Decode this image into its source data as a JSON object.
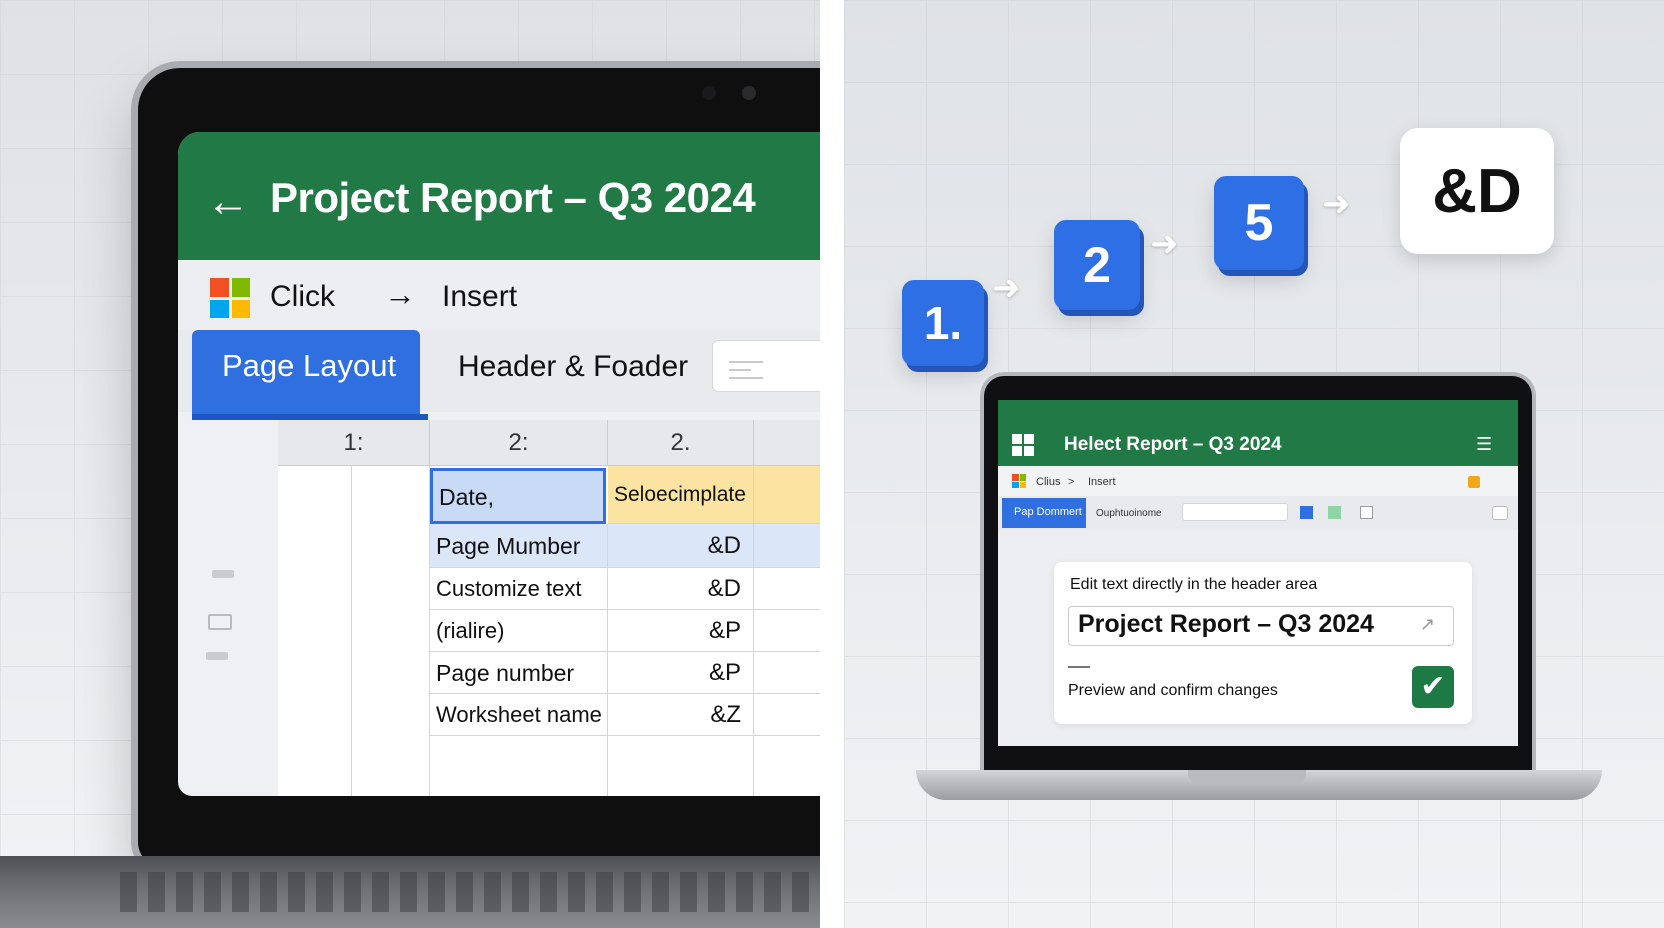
{
  "left": {
    "window_title": "Project Report – Q3 2024",
    "toolbar": {
      "click_label": "Click",
      "arrow": "→",
      "insert_label": "Insert"
    },
    "tabs": [
      {
        "label": "Page Layout",
        "active": true
      },
      {
        "label": "Header & Foader",
        "active": false
      }
    ],
    "table": {
      "columns": [
        "1:",
        "2:",
        "2."
      ],
      "rows": [
        {
          "label": "Date,",
          "value": "Seloecimplate",
          "state": "selected"
        },
        {
          "label": "Page Mumber",
          "value": "&D",
          "state": "highlight"
        },
        {
          "label": "Customize text",
          "value": "&D",
          "state": "normal"
        },
        {
          "label": "(rialire)",
          "value": "&P",
          "state": "normal"
        },
        {
          "label": "Page number",
          "value": "&P",
          "state": "normal"
        },
        {
          "label": "Worksheet name",
          "value": "&Z",
          "state": "normal"
        }
      ]
    }
  },
  "right": {
    "steps": [
      "1.",
      "2",
      "5"
    ],
    "result_code": "&D",
    "window_title": "Helect Report – Q3 2024",
    "toolbar": {
      "click_label": "Clius",
      "arrow": ">",
      "insert_label": "Insert"
    },
    "tabs": [
      {
        "label": "Pap Dommert",
        "active": true
      },
      {
        "label": "Ouphtuoinome",
        "active": false
      }
    ],
    "card": {
      "instruction": "Edit text directly in the header area",
      "field_value": "Project Report – Q3 2024",
      "preview_label": "Preview and confirm changes",
      "check_glyph": "✔"
    }
  },
  "colors": {
    "excel_green": "#217a46",
    "accent_blue": "#2f6fdf",
    "selection_fill": "#c9daf6",
    "template_fill": "#fbe3a2",
    "check_green": "#1e7a45"
  },
  "icons": {
    "back": "←",
    "microsoft_logo": "ms-logo-icon",
    "checkmark": "checkmark-icon"
  }
}
